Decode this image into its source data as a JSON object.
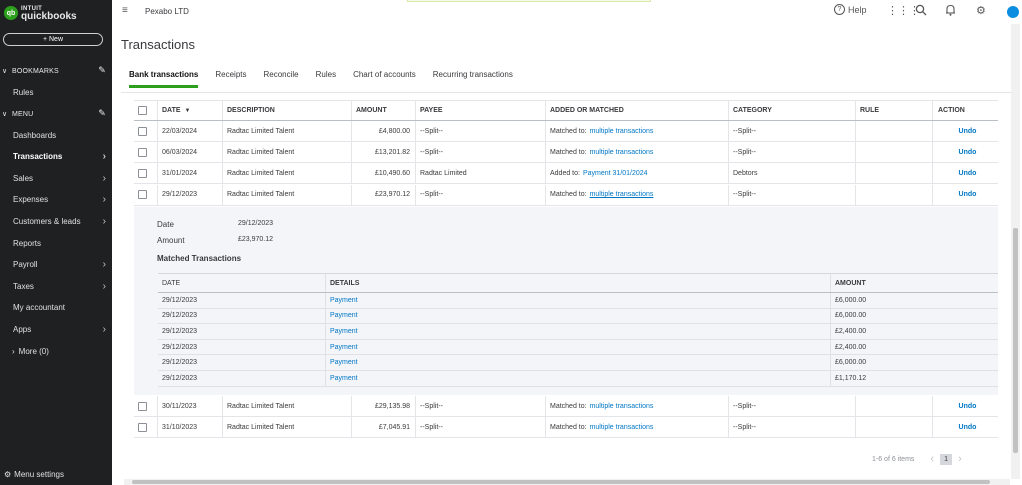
{
  "sidebar": {
    "logo_top": "INTUIT",
    "logo_bottom": "quickbooks",
    "logo_mark": "qb",
    "new_label": "+  New",
    "bookmarks_label": "BOOKMARKS",
    "rules_label": "Rules",
    "menu_label": "MENU",
    "items": [
      {
        "label": "Dashboards",
        "arrow": false
      },
      {
        "label": "Transactions",
        "arrow": true,
        "active": true
      },
      {
        "label": "Sales",
        "arrow": true
      },
      {
        "label": "Expenses",
        "arrow": true
      },
      {
        "label": "Customers & leads",
        "arrow": true
      },
      {
        "label": "Reports",
        "arrow": false
      },
      {
        "label": "Payroll",
        "arrow": true
      },
      {
        "label": "Taxes",
        "arrow": true
      },
      {
        "label": "My accountant",
        "arrow": false
      },
      {
        "label": "Apps",
        "arrow": true
      }
    ],
    "more_label": "More (0)",
    "menu_settings_label": "Menu settings"
  },
  "topbar": {
    "company": "Pexabo LTD",
    "help_label": "Help",
    "icons": [
      "apps-grid-icon",
      "search-icon",
      "bell-icon",
      "gear-icon",
      "avatar"
    ]
  },
  "page": {
    "title": "Transactions",
    "tabs": [
      "Bank transactions",
      "Receipts",
      "Reconcile",
      "Rules",
      "Chart of accounts",
      "Recurring transactions"
    ],
    "active_tab": "Bank transactions"
  },
  "table": {
    "headers": {
      "date": "DATE",
      "sort_icon": "▼",
      "description": "DESCRIPTION",
      "amount": "AMOUNT",
      "payee": "PAYEE",
      "added_or_matched": "ADDED OR MATCHED",
      "category": "CATEGORY",
      "rule": "RULE",
      "action": "ACTION"
    },
    "rows_top": [
      {
        "date": "22/03/2024",
        "description": "Radtac Limited Talent",
        "amount": "£4,800.00",
        "payee": "--Split--",
        "matched_prefix": "Matched to:",
        "matched_link": "multiple transactions",
        "category": "--Split--",
        "rule": "",
        "action": "Undo",
        "underline": false
      },
      {
        "date": "06/03/2024",
        "description": "Radtac Limited Talent",
        "amount": "£13,201.82",
        "payee": "--Split--",
        "matched_prefix": "Matched to:",
        "matched_link": "multiple transactions",
        "category": "--Split--",
        "rule": "",
        "action": "Undo",
        "underline": false
      },
      {
        "date": "31/01/2024",
        "description": "Radtac Limited Talent",
        "amount": "£10,490.60",
        "payee": "Radtac Limited",
        "matched_prefix": "Added to:",
        "matched_link": "Payment 31/01/2024",
        "category": "Debtors",
        "rule": "",
        "action": "Undo",
        "underline": false
      },
      {
        "date": "29/12/2023",
        "description": "Radtac Limited Talent",
        "amount": "£23,970.12",
        "payee": "--Split--",
        "matched_prefix": "Matched to:",
        "matched_link": "multiple transactions",
        "category": "--Split--",
        "rule": "",
        "action": "Undo",
        "underline": true
      }
    ],
    "rows_bottom": [
      {
        "date": "30/11/2023",
        "description": "Radtac Limited Talent",
        "amount": "£29,135.98",
        "payee": "--Split--",
        "matched_prefix": "Matched to:",
        "matched_link": "multiple transactions",
        "category": "--Split--",
        "rule": "",
        "action": "Undo",
        "underline": false
      },
      {
        "date": "31/10/2023",
        "description": "Radtac Limited Talent",
        "amount": "£7,045.91",
        "payee": "--Split--",
        "matched_prefix": "Matched to:",
        "matched_link": "multiple transactions",
        "category": "--Split--",
        "rule": "",
        "action": "Undo",
        "underline": false
      }
    ]
  },
  "expanded": {
    "date_label": "Date",
    "date_value": "29/12/2023",
    "amount_label": "Amount",
    "amount_value": "£23,970.12",
    "matched_title": "Matched Transactions",
    "headers": {
      "date": "DATE",
      "details": "DETAILS",
      "amount": "AMOUNT"
    },
    "rows": [
      {
        "date": "29/12/2023",
        "details": "Payment",
        "amount": "£6,000.00"
      },
      {
        "date": "29/12/2023",
        "details": "Payment",
        "amount": "£6,000.00"
      },
      {
        "date": "29/12/2023",
        "details": "Payment",
        "amount": "£2,400.00"
      },
      {
        "date": "29/12/2023",
        "details": "Payment",
        "amount": "£2,400.00"
      },
      {
        "date": "29/12/2023",
        "details": "Payment",
        "amount": "£6,000.00"
      },
      {
        "date": "29/12/2023",
        "details": "Payment",
        "amount": "£1,170.12"
      }
    ]
  },
  "pagination": {
    "summary": "1-6 of 6 items",
    "current_page": "1"
  },
  "colors": {
    "sidebar_bg": "#1f2022",
    "brand_green": "#2ca01c",
    "link_blue": "#0077c5",
    "avatar_blue": "#0d8ddf"
  }
}
